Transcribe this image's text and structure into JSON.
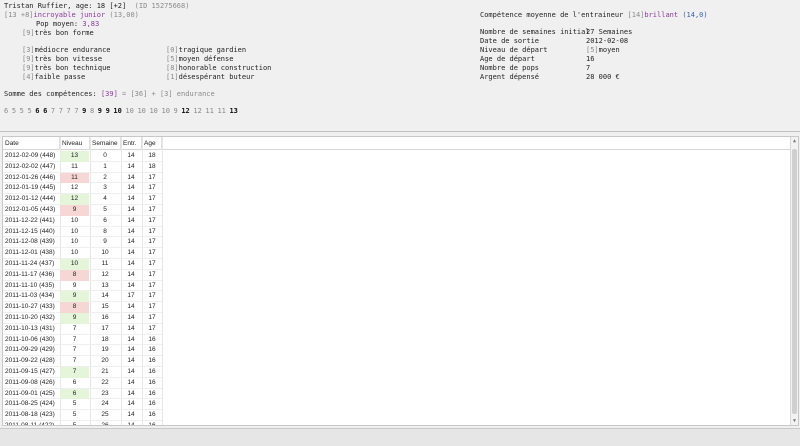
{
  "player": {
    "name_line": "Tristan Ruffier, age: 18 [+2]",
    "id": "(ID 15275668)",
    "form_bracket": "[13 +8]",
    "form_text": "incroyable junior",
    "form_value": "(13,00)",
    "pop_label": "Pop moyen: ",
    "pop_value": "3,83",
    "shape_level": "[9]",
    "shape_text": "très bon forme"
  },
  "skills_left": [
    {
      "level": "[3]",
      "text": "médiocre endurance"
    },
    {
      "level": "[9]",
      "text": "très bon vitesse"
    },
    {
      "level": "[9]",
      "text": "très bon technique"
    },
    {
      "level": "[4]",
      "text": "faible passe"
    }
  ],
  "skills_right": [
    {
      "level": "[0]",
      "text": "tragique gardien"
    },
    {
      "level": "[5]",
      "text": "moyen défense"
    },
    {
      "level": "[8]",
      "text": "honorable construction"
    },
    {
      "level": "[1]",
      "text": "désespérant buteur"
    }
  ],
  "sum_line": {
    "label": "Somme des compétences: ",
    "total": "[39]",
    "eq": " = [36] + ",
    "endurance": "[3] endurance"
  },
  "skill_sequence": [
    {
      "v": "6",
      "s": "l"
    },
    {
      "v": "5",
      "s": "l"
    },
    {
      "v": "5",
      "s": "l"
    },
    {
      "v": "5",
      "s": "l"
    },
    {
      "v": "6",
      "s": "b"
    },
    {
      "v": "6",
      "s": "b"
    },
    {
      "v": "7",
      "s": "l"
    },
    {
      "v": "7",
      "s": "l"
    },
    {
      "v": "7",
      "s": "l"
    },
    {
      "v": "7",
      "s": "l"
    },
    {
      "v": "9",
      "s": "b"
    },
    {
      "v": "8",
      "s": "l"
    },
    {
      "v": "9",
      "s": "b"
    },
    {
      "v": "9",
      "s": "b"
    },
    {
      "v": "10",
      "s": "b"
    },
    {
      "v": "10",
      "s": "l"
    },
    {
      "v": "10",
      "s": "l"
    },
    {
      "v": "10",
      "s": "l"
    },
    {
      "v": "10",
      "s": "l"
    },
    {
      "v": "9",
      "s": "l"
    },
    {
      "v": "12",
      "s": "b"
    },
    {
      "v": "12",
      "s": "l"
    },
    {
      "v": "11",
      "s": "l"
    },
    {
      "v": "11",
      "s": "l"
    },
    {
      "v": "13",
      "s": "b"
    }
  ],
  "coach": {
    "label": "Compétence moyenne de l'entraineur ",
    "level": "[14]",
    "text": "brillant",
    "value": "(14,0)"
  },
  "info": [
    {
      "label": "Nombre de semaines initial",
      "value": "27 Semaines"
    },
    {
      "label": "Date de sortie",
      "value": "2012-02-08"
    },
    {
      "label": "Niveau de départ",
      "level": "[5]",
      "value": "moyen"
    },
    {
      "label": "Age de départ",
      "value": "16"
    },
    {
      "label": "Nombre de pops",
      "value": "7"
    },
    {
      "label": "Argent dépensé",
      "value": "28 000 €"
    }
  ],
  "table": {
    "headers": [
      "Date",
      "Niveau",
      "Semaine",
      "Entr.",
      "Age"
    ],
    "rows": [
      [
        "2012-02-09 (448)",
        "13",
        "0",
        "14",
        "18",
        "up"
      ],
      [
        "2012-02-02 (447)",
        "11",
        "1",
        "14",
        "18",
        ""
      ],
      [
        "2012-01-26 (446)",
        "11",
        "2",
        "14",
        "17",
        "down"
      ],
      [
        "2012-01-19 (445)",
        "12",
        "3",
        "14",
        "17",
        ""
      ],
      [
        "2012-01-12 (444)",
        "12",
        "4",
        "14",
        "17",
        "up"
      ],
      [
        "2012-01-05 (443)",
        "9",
        "5",
        "14",
        "17",
        "down"
      ],
      [
        "2011-12-22 (441)",
        "10",
        "6",
        "14",
        "17",
        ""
      ],
      [
        "2011-12-15 (440)",
        "10",
        "8",
        "14",
        "17",
        ""
      ],
      [
        "2011-12-08 (439)",
        "10",
        "9",
        "14",
        "17",
        ""
      ],
      [
        "2011-12-01 (438)",
        "10",
        "10",
        "14",
        "17",
        ""
      ],
      [
        "2011-11-24 (437)",
        "10",
        "11",
        "14",
        "17",
        "up"
      ],
      [
        "2011-11-17 (436)",
        "8",
        "12",
        "14",
        "17",
        "down"
      ],
      [
        "2011-11-10 (435)",
        "9",
        "13",
        "14",
        "17",
        ""
      ],
      [
        "2011-11-03 (434)",
        "9",
        "14",
        "17",
        "17",
        "up"
      ],
      [
        "2011-10-27 (433)",
        "8",
        "15",
        "14",
        "17",
        "down"
      ],
      [
        "2011-10-20 (432)",
        "9",
        "16",
        "14",
        "17",
        "up"
      ],
      [
        "2011-10-13 (431)",
        "7",
        "17",
        "14",
        "17",
        ""
      ],
      [
        "2011-10-06 (430)",
        "7",
        "18",
        "14",
        "16",
        ""
      ],
      [
        "2011-09-29 (429)",
        "7",
        "19",
        "14",
        "16",
        ""
      ],
      [
        "2011-09-22 (428)",
        "7",
        "20",
        "14",
        "16",
        ""
      ],
      [
        "2011-09-15 (427)",
        "7",
        "21",
        "14",
        "16",
        "up"
      ],
      [
        "2011-09-08 (426)",
        "6",
        "22",
        "14",
        "16",
        ""
      ],
      [
        "2011-09-01 (425)",
        "6",
        "23",
        "14",
        "16",
        "up"
      ],
      [
        "2011-08-25 (424)",
        "5",
        "24",
        "14",
        "16",
        ""
      ],
      [
        "2011-08-18 (423)",
        "5",
        "25",
        "14",
        "16",
        ""
      ],
      [
        "2011-08-11 (422)",
        "5",
        "26",
        "14",
        "16",
        ""
      ]
    ]
  }
}
